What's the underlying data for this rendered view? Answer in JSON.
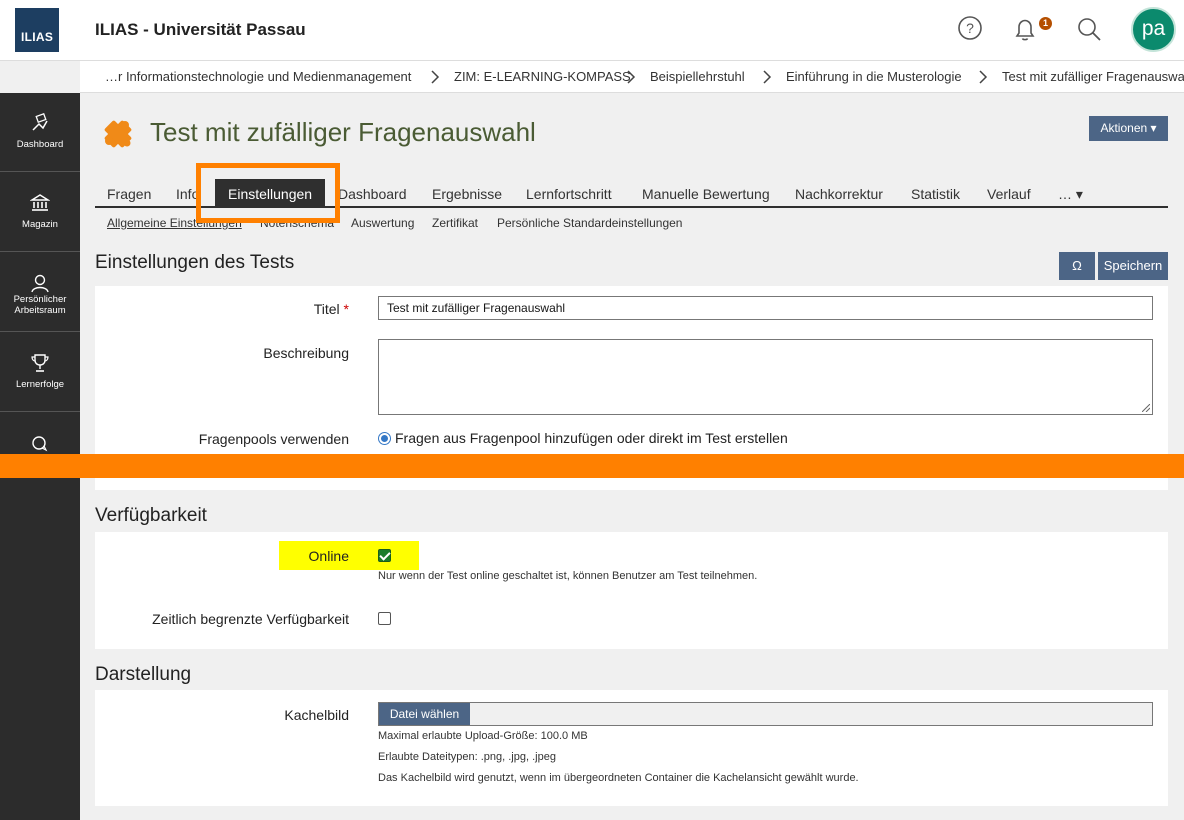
{
  "header": {
    "logo_text": "ILIAS",
    "app_title": "ILIAS - Universität Passau",
    "notification_count": "1",
    "avatar_initials": "pa"
  },
  "breadcrumb": [
    "…r Informationstechnologie und Medienmanagement",
    "ZIM: E-LEARNING-KOMPASS",
    "Beispiellehrstuhl",
    "Einführung in die Musterologie",
    "Test mit zufälliger Fragenauswahl"
  ],
  "sidebar": {
    "items": [
      {
        "label": "Dashboard",
        "icon": "dashboard-icon"
      },
      {
        "label": "Magazin",
        "icon": "bank-icon"
      },
      {
        "label": "Persönlicher Arbeitsraum",
        "label_line1": "Persönlicher",
        "label_line2": "Arbeitsraum",
        "icon": "user-icon"
      },
      {
        "label": "Lernerfolge",
        "icon": "trophy-icon"
      },
      {
        "label": "",
        "icon": "chat-icon"
      }
    ]
  },
  "page": {
    "title": "Test mit zufälliger Fragenauswahl",
    "actions_label": "Aktionen ▾",
    "tabs": [
      "Fragen",
      "Info",
      "Einstellungen",
      "Dashboard",
      "Ergebnisse",
      "Lernfortschritt",
      "Manuelle Bewertung",
      "Nachkorrektur",
      "Statistik",
      "Verlauf",
      "… ▾"
    ],
    "active_tab": "Einstellungen",
    "subtabs": [
      "Allgemeine Einstellungen",
      "Notenschema",
      "Auswertung",
      "Zertifikat",
      "Persönliche Standardeinstellungen"
    ]
  },
  "settings": {
    "heading": "Einstellungen des Tests",
    "omega_label": "Ω",
    "save_label": "Speichern",
    "title_label": "Titel",
    "required_mark": "*",
    "title_value": "Test mit zufälliger Fragenauswahl",
    "description_label": "Beschreibung",
    "description_value": "",
    "pools_label": "Fragenpools verwenden",
    "pools_option": "Fragen aus Fragenpool hinzufügen oder direkt im Test erstellen",
    "pools_selected": true
  },
  "availability": {
    "heading": "Verfügbarkeit",
    "online_label": "Online",
    "online_checked": true,
    "online_help": "Nur wenn der Test online geschaltet ist, können Benutzer am Test teilnehmen.",
    "limited_label": "Zeitlich begrenzte Verfügbarkeit",
    "limited_checked": false
  },
  "presentation": {
    "heading": "Darstellung",
    "tile_label": "Kachelbild",
    "file_button": "Datei wählen",
    "help_1": "Maximal erlaubte Upload-Größe: 100.0 MB",
    "help_2": "Erlaubte Dateitypen: .png, .jpg, .jpeg",
    "help_3": "Das Kachelbild wird genutzt, wenn im übergeordneten Container die Kachelansicht gewählt wurde."
  },
  "colors": {
    "accent": "#4c6586",
    "annotation": "#ff8000",
    "highlight": "#ffff00",
    "title_green": "#4a5b34"
  }
}
